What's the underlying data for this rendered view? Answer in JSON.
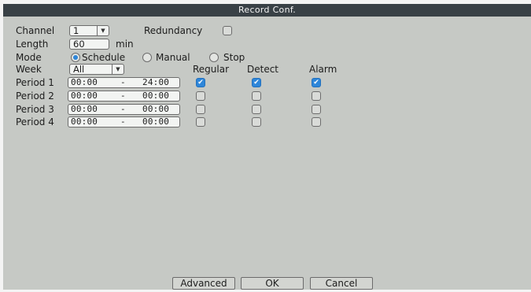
{
  "title": "Record Conf.",
  "channel": {
    "label": "Channel",
    "value": "1"
  },
  "redundancy": {
    "label": "Redundancy",
    "checked": false
  },
  "length": {
    "label": "Length",
    "value": "60",
    "unit": "min"
  },
  "mode": {
    "label": "Mode",
    "options": [
      "Schedule",
      "Manual",
      "Stop"
    ],
    "selected": "Schedule"
  },
  "week": {
    "label": "Week",
    "value": "All"
  },
  "columns": {
    "regular": "Regular",
    "detect": "Detect",
    "alarm": "Alarm"
  },
  "periods": [
    {
      "label": "Period 1",
      "start": "00:00",
      "sep": "-",
      "end": "24:00",
      "regular": true,
      "detect": true,
      "alarm": true
    },
    {
      "label": "Period 2",
      "start": "00:00",
      "sep": "-",
      "end": "00:00",
      "regular": false,
      "detect": false,
      "alarm": false
    },
    {
      "label": "Period 3",
      "start": "00:00",
      "sep": "-",
      "end": "00:00",
      "regular": false,
      "detect": false,
      "alarm": false
    },
    {
      "label": "Period 4",
      "start": "00:00",
      "sep": "-",
      "end": "00:00",
      "regular": false,
      "detect": false,
      "alarm": false
    }
  ],
  "buttons": {
    "advanced": "Advanced",
    "ok": "OK",
    "cancel": "Cancel"
  },
  "colors": {
    "titlebar": "#394146",
    "panel": "#c6c9c5",
    "accent": "#2e86d9"
  }
}
